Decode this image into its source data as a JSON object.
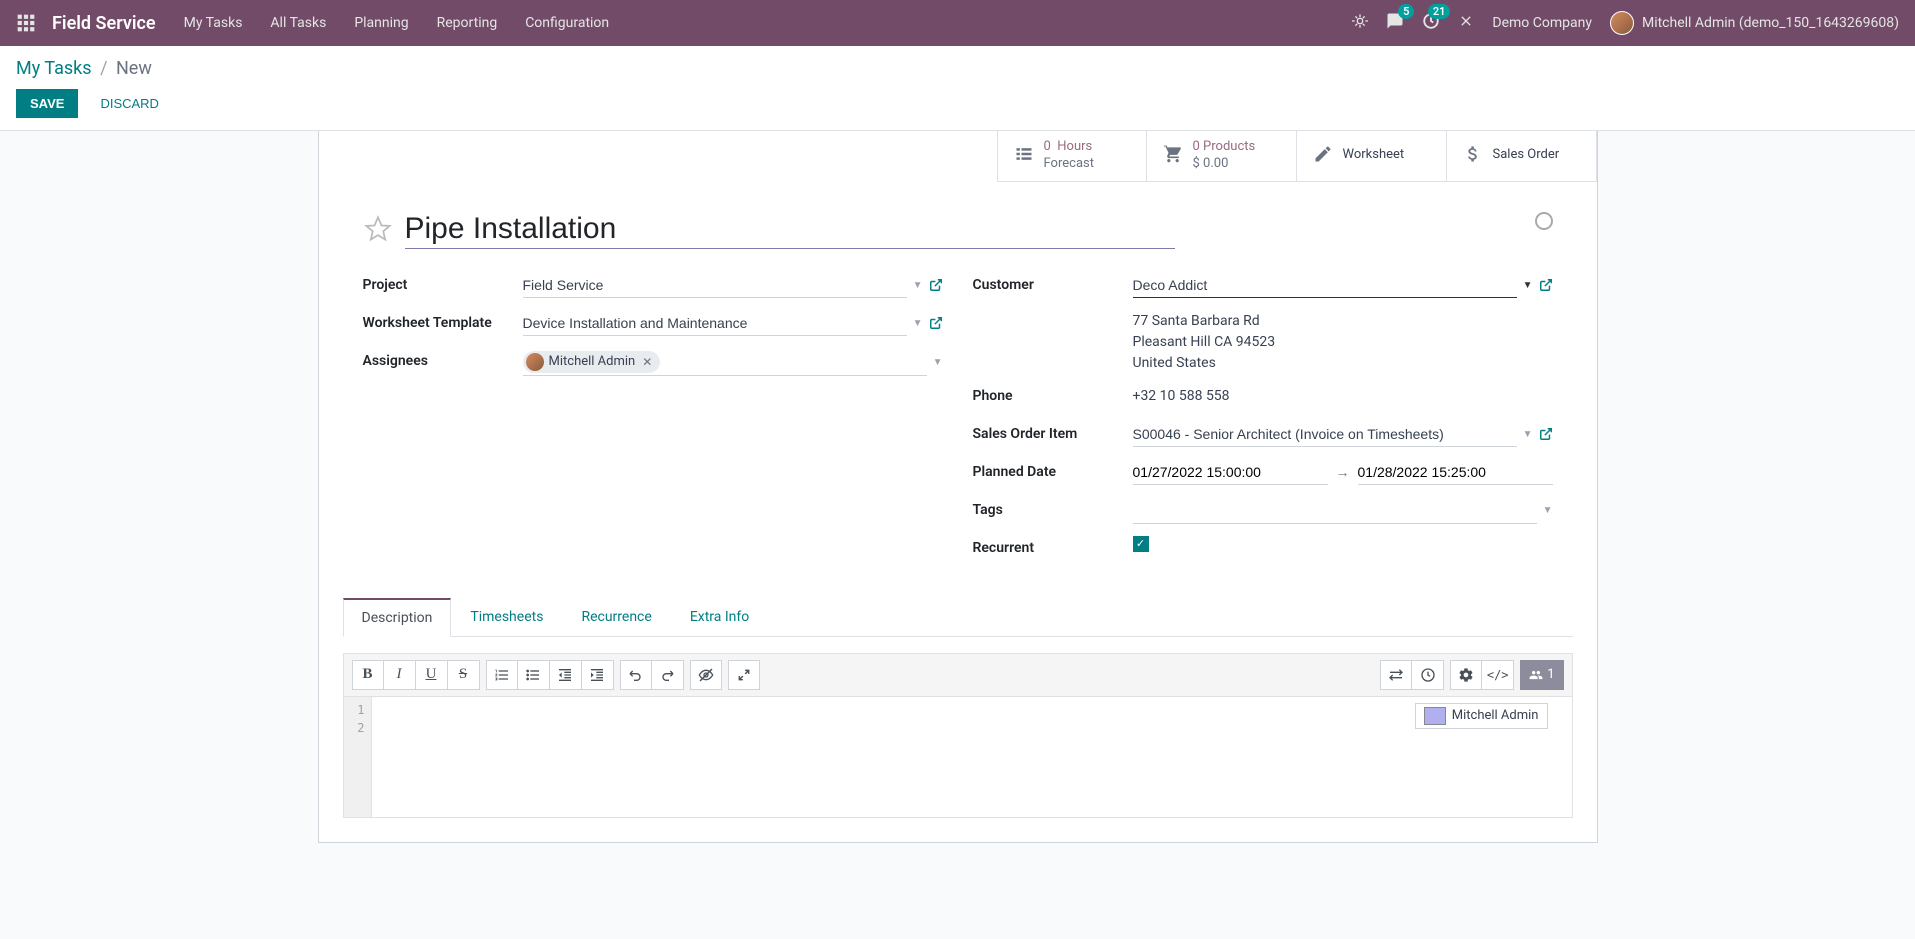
{
  "topbar": {
    "app_title": "Field Service",
    "nav": [
      "My Tasks",
      "All Tasks",
      "Planning",
      "Reporting",
      "Configuration"
    ],
    "messaging_badge": "5",
    "activities_badge": "21",
    "company": "Demo Company",
    "user_display": "Mitchell Admin (demo_150_1643269608)"
  },
  "breadcrumb": {
    "root": "My Tasks",
    "current": "New"
  },
  "buttons": {
    "save": "SAVE",
    "discard": "DISCARD"
  },
  "stats": {
    "hours_count": "0",
    "hours_label": "Hours",
    "forecast": "Forecast",
    "products_count": "0",
    "products_label": "Products",
    "products_amount": "$ 0.00",
    "worksheet": "Worksheet",
    "sales_order": "Sales Order"
  },
  "task": {
    "title": "Pipe Installation"
  },
  "labels": {
    "project": "Project",
    "worksheet_template": "Worksheet Template",
    "assignees": "Assignees",
    "customer": "Customer",
    "phone": "Phone",
    "sales_order_item": "Sales Order Item",
    "planned_date": "Planned Date",
    "tags": "Tags",
    "recurrent": "Recurrent"
  },
  "form": {
    "project": "Field Service",
    "worksheet_template": "Device Installation and Maintenance",
    "assignee_name": "Mitchell Admin",
    "customer": "Deco Addict",
    "address_line1": "77 Santa Barbara Rd",
    "address_line2": "Pleasant Hill CA 94523",
    "address_line3": "United States",
    "phone": "+32 10 588 558",
    "sales_order_item": "S00046 - Senior Architect (Invoice on Timesheets)",
    "date_from": "01/27/2022 15:00:00",
    "date_to": "01/28/2022 15:25:00"
  },
  "tabs": [
    "Description",
    "Timesheets",
    "Recurrence",
    "Extra Info"
  ],
  "editor": {
    "gutter": [
      "1",
      "2"
    ],
    "collab_user": "Mitchell Admin",
    "collab_count": "1"
  }
}
